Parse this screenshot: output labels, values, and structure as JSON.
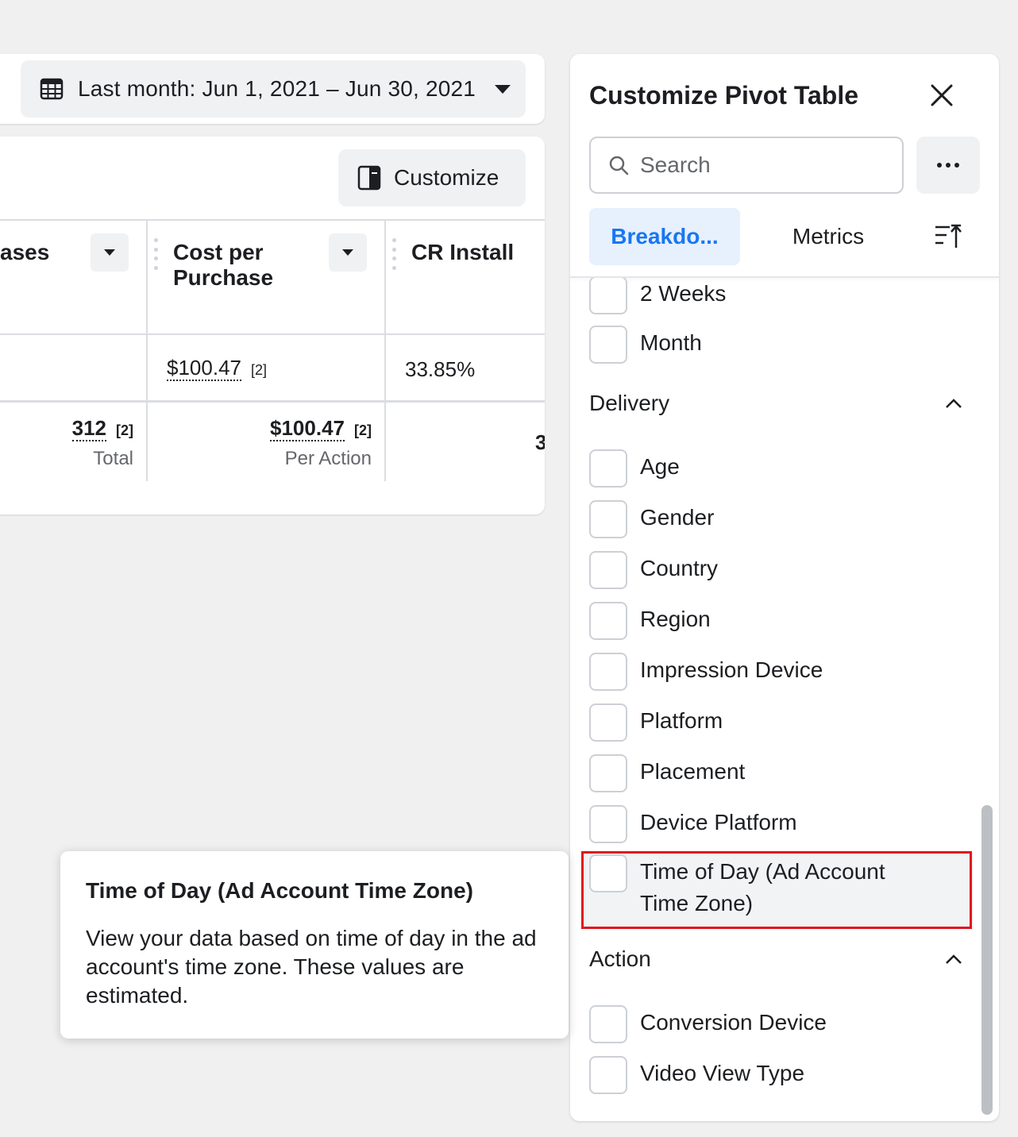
{
  "date_range": {
    "label": "Last month: Jun 1, 2021 – Jun 30, 2021"
  },
  "toolbar": {
    "customize_label": "Customize"
  },
  "table": {
    "columns": [
      {
        "label": "ases"
      },
      {
        "label": "Cost per Purchase"
      },
      {
        "label": "CR Install"
      }
    ],
    "row": {
      "cost_per_purchase": "$100.47",
      "cost_ref": "[2]",
      "cr_install": "33.85%"
    },
    "totals": {
      "purchases_value": "312",
      "purchases_ref": "[2]",
      "purchases_sub": "Total",
      "cost_value": "$100.47",
      "cost_ref": "[2]",
      "cost_sub": "Per Action",
      "cr_cutoff": "3"
    }
  },
  "panel": {
    "title": "Customize Pivot Table",
    "search_placeholder": "Search",
    "tabs": {
      "breakdowns": "Breakdo...",
      "metrics": "Metrics"
    },
    "time_items": [
      "2 Weeks",
      "Month"
    ],
    "delivery": {
      "header": "Delivery",
      "items": [
        "Age",
        "Gender",
        "Country",
        "Region",
        "Impression Device",
        "Platform",
        "Placement",
        "Device Platform",
        "Time of Day (Ad Account Time Zone)"
      ]
    },
    "action": {
      "header": "Action",
      "items": [
        "Conversion Device",
        "Video View Type"
      ]
    }
  },
  "tooltip": {
    "title": "Time of Day (Ad Account Time Zone)",
    "body": "View your data based on time of day in the ad account's time zone. These values are estimated."
  },
  "colors": {
    "accent": "#1877f2",
    "highlight_border": "#e0141e"
  }
}
